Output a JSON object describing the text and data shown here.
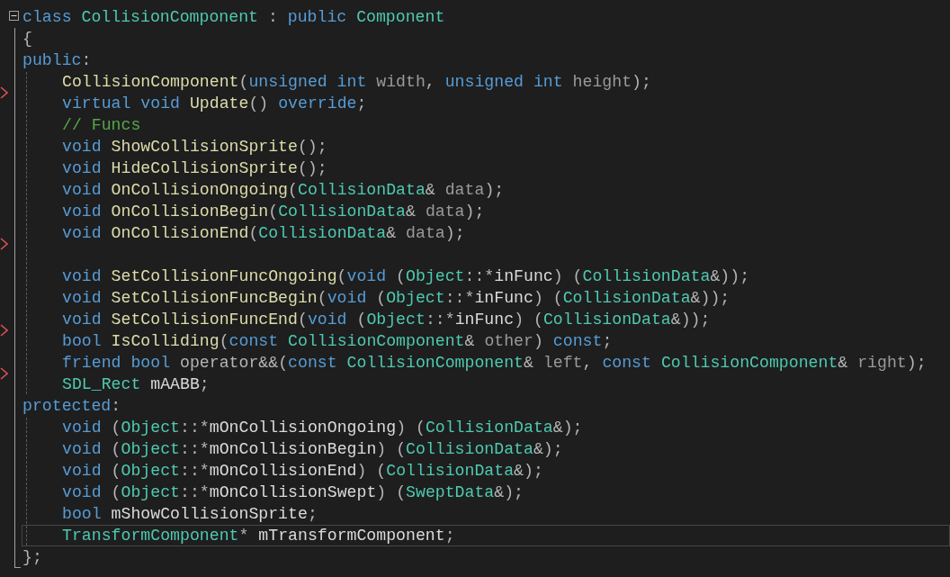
{
  "fold": {
    "expanded": true
  },
  "lines": [
    {
      "indented": false,
      "current": false,
      "marker": false,
      "tokens": [
        {
          "kind": "keyword",
          "text": "class "
        },
        {
          "kind": "type",
          "text": "CollisionComponent"
        },
        {
          "kind": "punct",
          "text": " : "
        },
        {
          "kind": "keyword",
          "text": "public "
        },
        {
          "kind": "type",
          "text": "Component"
        }
      ]
    },
    {
      "indented": false,
      "current": false,
      "marker": false,
      "tokens": [
        {
          "kind": "punct",
          "text": "{"
        }
      ]
    },
    {
      "indented": false,
      "current": false,
      "marker": false,
      "tokens": [
        {
          "kind": "keyword",
          "text": "public"
        },
        {
          "kind": "punct",
          "text": ":"
        }
      ]
    },
    {
      "indented": true,
      "current": false,
      "marker": true,
      "tokens": [
        {
          "kind": "function",
          "text": "CollisionComponent"
        },
        {
          "kind": "punct",
          "text": "("
        },
        {
          "kind": "keyword",
          "text": "unsigned int "
        },
        {
          "kind": "param",
          "text": "width"
        },
        {
          "kind": "punct",
          "text": ", "
        },
        {
          "kind": "keyword",
          "text": "unsigned int "
        },
        {
          "kind": "param",
          "text": "height"
        },
        {
          "kind": "punct",
          "text": ");"
        }
      ]
    },
    {
      "indented": true,
      "current": false,
      "marker": false,
      "tokens": [
        {
          "kind": "keyword",
          "text": "virtual void "
        },
        {
          "kind": "function",
          "text": "Update"
        },
        {
          "kind": "punct",
          "text": "() "
        },
        {
          "kind": "keyword",
          "text": "override"
        },
        {
          "kind": "punct",
          "text": ";"
        }
      ]
    },
    {
      "indented": true,
      "current": false,
      "marker": false,
      "tokens": [
        {
          "kind": "comment",
          "text": "// Funcs"
        }
      ]
    },
    {
      "indented": true,
      "current": false,
      "marker": false,
      "tokens": [
        {
          "kind": "keyword",
          "text": "void "
        },
        {
          "kind": "function",
          "text": "ShowCollisionSprite"
        },
        {
          "kind": "punct",
          "text": "();"
        }
      ]
    },
    {
      "indented": true,
      "current": false,
      "marker": false,
      "tokens": [
        {
          "kind": "keyword",
          "text": "void "
        },
        {
          "kind": "function",
          "text": "HideCollisionSprite"
        },
        {
          "kind": "punct",
          "text": "();"
        }
      ]
    },
    {
      "indented": true,
      "current": false,
      "marker": false,
      "tokens": [
        {
          "kind": "keyword",
          "text": "void "
        },
        {
          "kind": "function",
          "text": "OnCollisionOngoing"
        },
        {
          "kind": "punct",
          "text": "("
        },
        {
          "kind": "type",
          "text": "CollisionData"
        },
        {
          "kind": "punct",
          "text": "& "
        },
        {
          "kind": "param",
          "text": "data"
        },
        {
          "kind": "punct",
          "text": ");"
        }
      ]
    },
    {
      "indented": true,
      "current": false,
      "marker": false,
      "tokens": [
        {
          "kind": "keyword",
          "text": "void "
        },
        {
          "kind": "function",
          "text": "OnCollisionBegin"
        },
        {
          "kind": "punct",
          "text": "("
        },
        {
          "kind": "type",
          "text": "CollisionData"
        },
        {
          "kind": "punct",
          "text": "& "
        },
        {
          "kind": "param",
          "text": "data"
        },
        {
          "kind": "punct",
          "text": ");"
        }
      ]
    },
    {
      "indented": true,
      "current": false,
      "marker": true,
      "tokens": [
        {
          "kind": "keyword",
          "text": "void "
        },
        {
          "kind": "function",
          "text": "OnCollisionEnd"
        },
        {
          "kind": "punct",
          "text": "("
        },
        {
          "kind": "type",
          "text": "CollisionData"
        },
        {
          "kind": "punct",
          "text": "& "
        },
        {
          "kind": "param",
          "text": "data"
        },
        {
          "kind": "punct",
          "text": ");"
        }
      ]
    },
    {
      "indented": true,
      "current": false,
      "marker": false
    },
    {
      "indented": true,
      "current": false,
      "marker": false,
      "tokens": [
        {
          "kind": "keyword",
          "text": "void "
        },
        {
          "kind": "function",
          "text": "SetCollisionFuncOngoing"
        },
        {
          "kind": "punct",
          "text": "("
        },
        {
          "kind": "keyword",
          "text": "void "
        },
        {
          "kind": "punct",
          "text": "("
        },
        {
          "kind": "type",
          "text": "Object"
        },
        {
          "kind": "punct",
          "text": "::*"
        },
        {
          "kind": "ident",
          "text": "inFunc"
        },
        {
          "kind": "punct",
          "text": ") ("
        },
        {
          "kind": "type",
          "text": "CollisionData"
        },
        {
          "kind": "punct",
          "text": "&));"
        }
      ]
    },
    {
      "indented": true,
      "current": false,
      "marker": false,
      "tokens": [
        {
          "kind": "keyword",
          "text": "void "
        },
        {
          "kind": "function",
          "text": "SetCollisionFuncBegin"
        },
        {
          "kind": "punct",
          "text": "("
        },
        {
          "kind": "keyword",
          "text": "void "
        },
        {
          "kind": "punct",
          "text": "("
        },
        {
          "kind": "type",
          "text": "Object"
        },
        {
          "kind": "punct",
          "text": "::*"
        },
        {
          "kind": "ident",
          "text": "inFunc"
        },
        {
          "kind": "punct",
          "text": ") ("
        },
        {
          "kind": "type",
          "text": "CollisionData"
        },
        {
          "kind": "punct",
          "text": "&));"
        }
      ]
    },
    {
      "indented": true,
      "current": false,
      "marker": true,
      "tokens": [
        {
          "kind": "keyword",
          "text": "void "
        },
        {
          "kind": "function",
          "text": "SetCollisionFuncEnd"
        },
        {
          "kind": "punct",
          "text": "("
        },
        {
          "kind": "keyword",
          "text": "void "
        },
        {
          "kind": "punct",
          "text": "("
        },
        {
          "kind": "type",
          "text": "Object"
        },
        {
          "kind": "punct",
          "text": "::*"
        },
        {
          "kind": "ident",
          "text": "inFunc"
        },
        {
          "kind": "punct",
          "text": ") ("
        },
        {
          "kind": "type",
          "text": "CollisionData"
        },
        {
          "kind": "punct",
          "text": "&));"
        }
      ]
    },
    {
      "indented": true,
      "current": false,
      "marker": false,
      "tokens": [
        {
          "kind": "keyword",
          "text": "bool "
        },
        {
          "kind": "function",
          "text": "IsColliding"
        },
        {
          "kind": "punct",
          "text": "("
        },
        {
          "kind": "keyword",
          "text": "const "
        },
        {
          "kind": "type",
          "text": "CollisionComponent"
        },
        {
          "kind": "punct",
          "text": "& "
        },
        {
          "kind": "param",
          "text": "other"
        },
        {
          "kind": "punct",
          "text": ") "
        },
        {
          "kind": "keyword",
          "text": "const"
        },
        {
          "kind": "punct",
          "text": ";"
        }
      ]
    },
    {
      "indented": true,
      "current": false,
      "marker": true,
      "tokens": [
        {
          "kind": "keyword",
          "text": "friend bool "
        },
        {
          "kind": "punct",
          "text": "operator&&("
        },
        {
          "kind": "keyword",
          "text": "const "
        },
        {
          "kind": "type",
          "text": "CollisionComponent"
        },
        {
          "kind": "punct",
          "text": "& "
        },
        {
          "kind": "param",
          "text": "left"
        },
        {
          "kind": "punct",
          "text": ", "
        },
        {
          "kind": "keyword",
          "text": "const "
        },
        {
          "kind": "type",
          "text": "CollisionComponent"
        },
        {
          "kind": "punct",
          "text": "& "
        },
        {
          "kind": "param",
          "text": "right"
        },
        {
          "kind": "punct",
          "text": ");"
        }
      ]
    },
    {
      "indented": true,
      "current": false,
      "marker": false,
      "tokens": [
        {
          "kind": "type",
          "text": "SDL_Rect "
        },
        {
          "kind": "ident",
          "text": "mAABB"
        },
        {
          "kind": "punct",
          "text": ";"
        }
      ]
    },
    {
      "indented": false,
      "current": false,
      "marker": false,
      "tokens": [
        {
          "kind": "keyword",
          "text": "protected"
        },
        {
          "kind": "punct",
          "text": ":"
        }
      ]
    },
    {
      "indented": true,
      "current": false,
      "marker": false,
      "tokens": [
        {
          "kind": "keyword",
          "text": "void "
        },
        {
          "kind": "punct",
          "text": "("
        },
        {
          "kind": "type",
          "text": "Object"
        },
        {
          "kind": "punct",
          "text": "::*"
        },
        {
          "kind": "ident",
          "text": "mOnCollisionOngoing"
        },
        {
          "kind": "punct",
          "text": ") ("
        },
        {
          "kind": "type",
          "text": "CollisionData"
        },
        {
          "kind": "punct",
          "text": "&);"
        }
      ]
    },
    {
      "indented": true,
      "current": false,
      "marker": false,
      "tokens": [
        {
          "kind": "keyword",
          "text": "void "
        },
        {
          "kind": "punct",
          "text": "("
        },
        {
          "kind": "type",
          "text": "Object"
        },
        {
          "kind": "punct",
          "text": "::*"
        },
        {
          "kind": "ident",
          "text": "mOnCollisionBegin"
        },
        {
          "kind": "punct",
          "text": ") ("
        },
        {
          "kind": "type",
          "text": "CollisionData"
        },
        {
          "kind": "punct",
          "text": "&);"
        }
      ]
    },
    {
      "indented": true,
      "current": false,
      "marker": false,
      "tokens": [
        {
          "kind": "keyword",
          "text": "void "
        },
        {
          "kind": "punct",
          "text": "("
        },
        {
          "kind": "type",
          "text": "Object"
        },
        {
          "kind": "punct",
          "text": "::*"
        },
        {
          "kind": "ident",
          "text": "mOnCollisionEnd"
        },
        {
          "kind": "punct",
          "text": ") ("
        },
        {
          "kind": "type",
          "text": "CollisionData"
        },
        {
          "kind": "punct",
          "text": "&);"
        }
      ]
    },
    {
      "indented": true,
      "current": false,
      "marker": false,
      "tokens": [
        {
          "kind": "keyword",
          "text": "void "
        },
        {
          "kind": "punct",
          "text": "("
        },
        {
          "kind": "type",
          "text": "Object"
        },
        {
          "kind": "punct",
          "text": "::*"
        },
        {
          "kind": "ident",
          "text": "mOnCollisionSwept"
        },
        {
          "kind": "punct",
          "text": ") ("
        },
        {
          "kind": "type",
          "text": "SweptData"
        },
        {
          "kind": "punct",
          "text": "&);"
        }
      ]
    },
    {
      "indented": true,
      "current": false,
      "marker": false,
      "tokens": [
        {
          "kind": "keyword",
          "text": "bool "
        },
        {
          "kind": "ident",
          "text": "mShowCollisionSprite"
        },
        {
          "kind": "punct",
          "text": ";"
        }
      ]
    },
    {
      "indented": true,
      "current": true,
      "marker": false,
      "tokens": [
        {
          "kind": "type",
          "text": "TransformComponent"
        },
        {
          "kind": "punct",
          "text": "* "
        },
        {
          "kind": "ident",
          "text": "mTransformComponent"
        },
        {
          "kind": "punct",
          "text": ";"
        }
      ]
    },
    {
      "indented": false,
      "current": false,
      "marker": false,
      "tokens": [
        {
          "kind": "punct",
          "text": "};"
        }
      ]
    }
  ]
}
